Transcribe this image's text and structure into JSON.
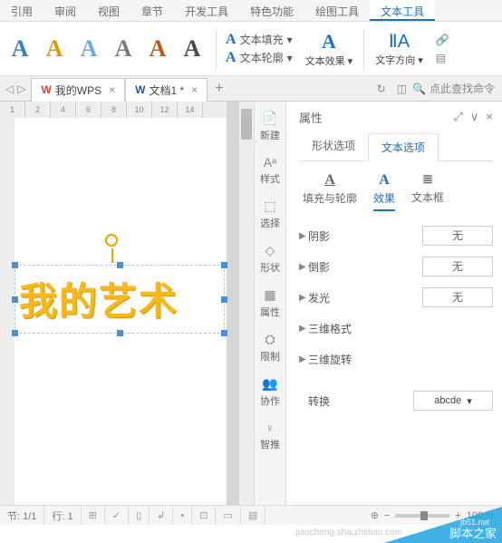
{
  "tabs": [
    "引用",
    "审阅",
    "视图",
    "章节",
    "开发工具",
    "特色功能",
    "绘图工具",
    "文本工具"
  ],
  "active_tab": 7,
  "ribbon": {
    "styles_colors": [
      "#3b7ec9",
      "#e09800",
      "#6fa8e2",
      "#7a7a7a",
      "#c05a1a",
      "#4a4a4a"
    ],
    "fill_label": "文本填充",
    "outline_label": "文本轮廓",
    "effect_label": "文本效果",
    "direction_label": "文字方向",
    "big_a_color": "#1e70bf",
    "decor_color": "#1e70bf"
  },
  "doctabs": {
    "wps_label": "我的WPS",
    "doc_label": "文档1 *"
  },
  "search_placeholder": "点此查找命令",
  "ruler": [
    "1",
    "2",
    "4",
    "6",
    "8",
    "10",
    "12",
    "14"
  ],
  "art_text": "我的艺术",
  "side_tools": [
    {
      "icon": "📄",
      "label": "新建"
    },
    {
      "icon": "Aᵃ",
      "label": "样式"
    },
    {
      "icon": "⬚",
      "label": "选择"
    },
    {
      "icon": "◇",
      "label": "形状"
    },
    {
      "icon": "▦",
      "label": "属性"
    },
    {
      "icon": "⛭",
      "label": "限制"
    },
    {
      "icon": "👥",
      "label": "协作"
    },
    {
      "icon": "♀",
      "label": "智推"
    }
  ],
  "panel": {
    "title": "属性",
    "option_tabs": [
      "形状选项",
      "文本选项"
    ],
    "active_option": 1,
    "sub_tabs": [
      {
        "icon": "A",
        "label": "填充与轮廓"
      },
      {
        "icon": "A",
        "label": "效果"
      },
      {
        "icon": "≣",
        "label": "文本框"
      }
    ],
    "active_sub": 1,
    "rows": [
      {
        "label": "阴影",
        "value": "无"
      },
      {
        "label": "倒影",
        "value": "无"
      },
      {
        "label": "发光",
        "value": "无"
      },
      {
        "label": "三维格式",
        "value": null
      },
      {
        "label": "三维旋转",
        "value": null
      }
    ],
    "transform_label": "转换",
    "transform_value": "abcde"
  },
  "status": {
    "section": "节: 1/1",
    "line": "行: 1",
    "zoom": "100 %"
  },
  "watermark": {
    "main": "脚本之家",
    "sub": "jb51.net",
    "faint": "jiaocheng.sha.zhidian.com"
  }
}
